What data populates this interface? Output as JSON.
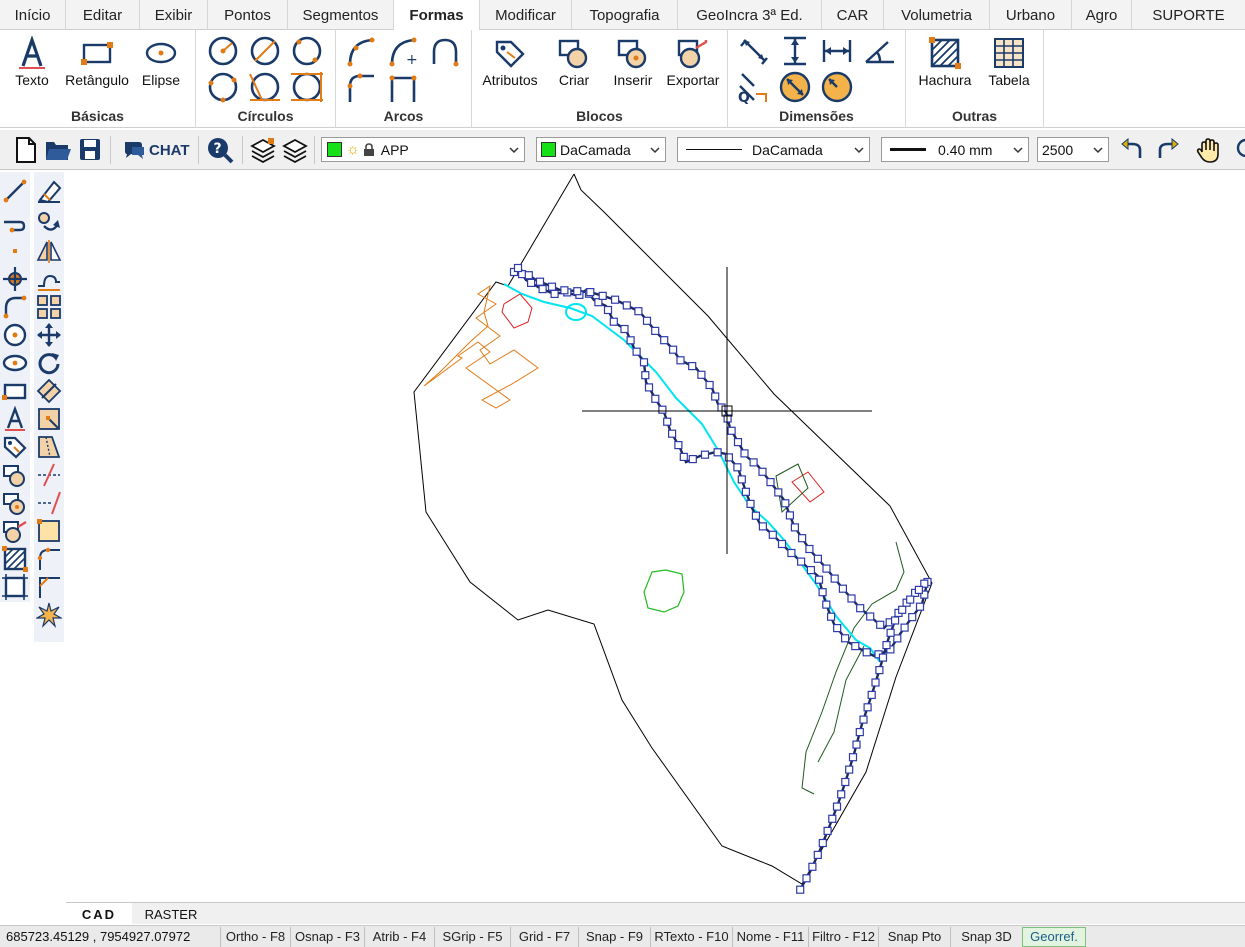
{
  "tabs": [
    "Início",
    "Editar",
    "Exibir",
    "Pontos",
    "Segmentos",
    "Formas",
    "Modificar",
    "Topografia",
    "GeoIncra 3ª Ed.",
    "CAR",
    "Volumetria",
    "Urbano",
    "Agro",
    "SUPORTE"
  ],
  "active_tab": "Formas",
  "ribbon": {
    "basicas": {
      "title": "Básicas",
      "texto": "Texto",
      "retangulo": "Retângulo",
      "elipse": "Elipse"
    },
    "circulos": {
      "title": "Círculos"
    },
    "arcos": {
      "title": "Arcos"
    },
    "blocos": {
      "title": "Blocos",
      "atributos": "Atributos",
      "criar": "Criar",
      "inserir": "Inserir",
      "exportar": "Exportar"
    },
    "dimensoes": {
      "title": "Dimensões"
    },
    "outras": {
      "title": "Outras",
      "hachura": "Hachura",
      "tabela": "Tabela"
    }
  },
  "toolbar": {
    "chat_label": "CHAT",
    "layer": "APP",
    "color": "DaCamada",
    "linetype": "DaCamada",
    "lineweight": "0.40 mm",
    "scale": "2500",
    "layer_color": "#16e016"
  },
  "view_tabs": [
    "CAD",
    "RASTER"
  ],
  "active_view_tab": "CAD",
  "status": {
    "coords": "685723.45129 , 7954927.07972",
    "buttons": [
      "Ortho - F8",
      "Osnap - F3",
      "Atrib - F4",
      "SGrip - F5",
      "Grid - F7",
      "Snap - F9",
      "RTexto - F10",
      "Nome - F11",
      "Filtro - F12",
      "Snap Pto",
      "Snap 3D",
      "Georref."
    ],
    "active_button": "Georref."
  },
  "colors": {
    "selected_polyline": "#1a2a5a",
    "grip": "#2d3aa8",
    "river": "#00e5ee",
    "orange_shape": "#e07b16",
    "red_shape": "#e02020",
    "green_shape": "#22bb22",
    "dark_green_line": "#1e5a1e",
    "boundary": "#000000"
  }
}
